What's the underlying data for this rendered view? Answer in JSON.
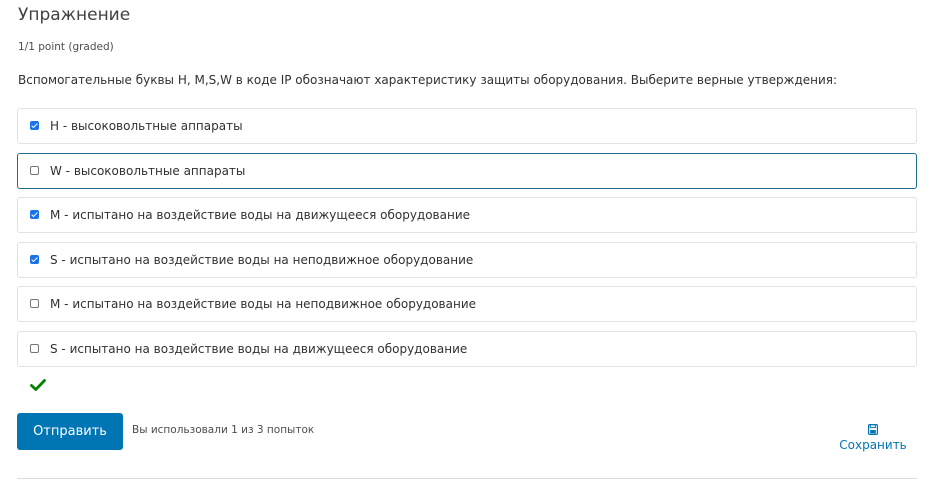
{
  "problem": {
    "title": "Упражнение",
    "points": "1/1 point (graded)",
    "question": "Вспомогательные буквы H, M,S,W в коде IP обозначают характеристику защиты оборудования. Выберите верные утверждения:"
  },
  "options": [
    {
      "label": "H - высоковольтные аппараты",
      "checked": true
    },
    {
      "label": "W - высоковольтные аппараты",
      "checked": false
    },
    {
      "label": "M - испытано на воздействие воды на движущееся оборудование",
      "checked": true
    },
    {
      "label": "S - испытано на воздействие воды на неподвижное оборудование",
      "checked": true
    },
    {
      "label": "M - испытано на воздействие воды на неподвижное оборудование",
      "checked": false
    },
    {
      "label": "S - испытано на воздействие воды на движущееся оборудование",
      "checked": false
    }
  ],
  "status": {
    "icon": "checkmark-icon",
    "color": "#008100"
  },
  "actions": {
    "submit_label": "Отправить",
    "attempts_text": "Вы использовали 1 из 3 попыток",
    "save_label": "Сохранить",
    "save_icon": "floppy-disk-icon"
  },
  "colors": {
    "accent": "#0075b4",
    "checkbox": "#1a73e8",
    "correct": "#008100"
  }
}
